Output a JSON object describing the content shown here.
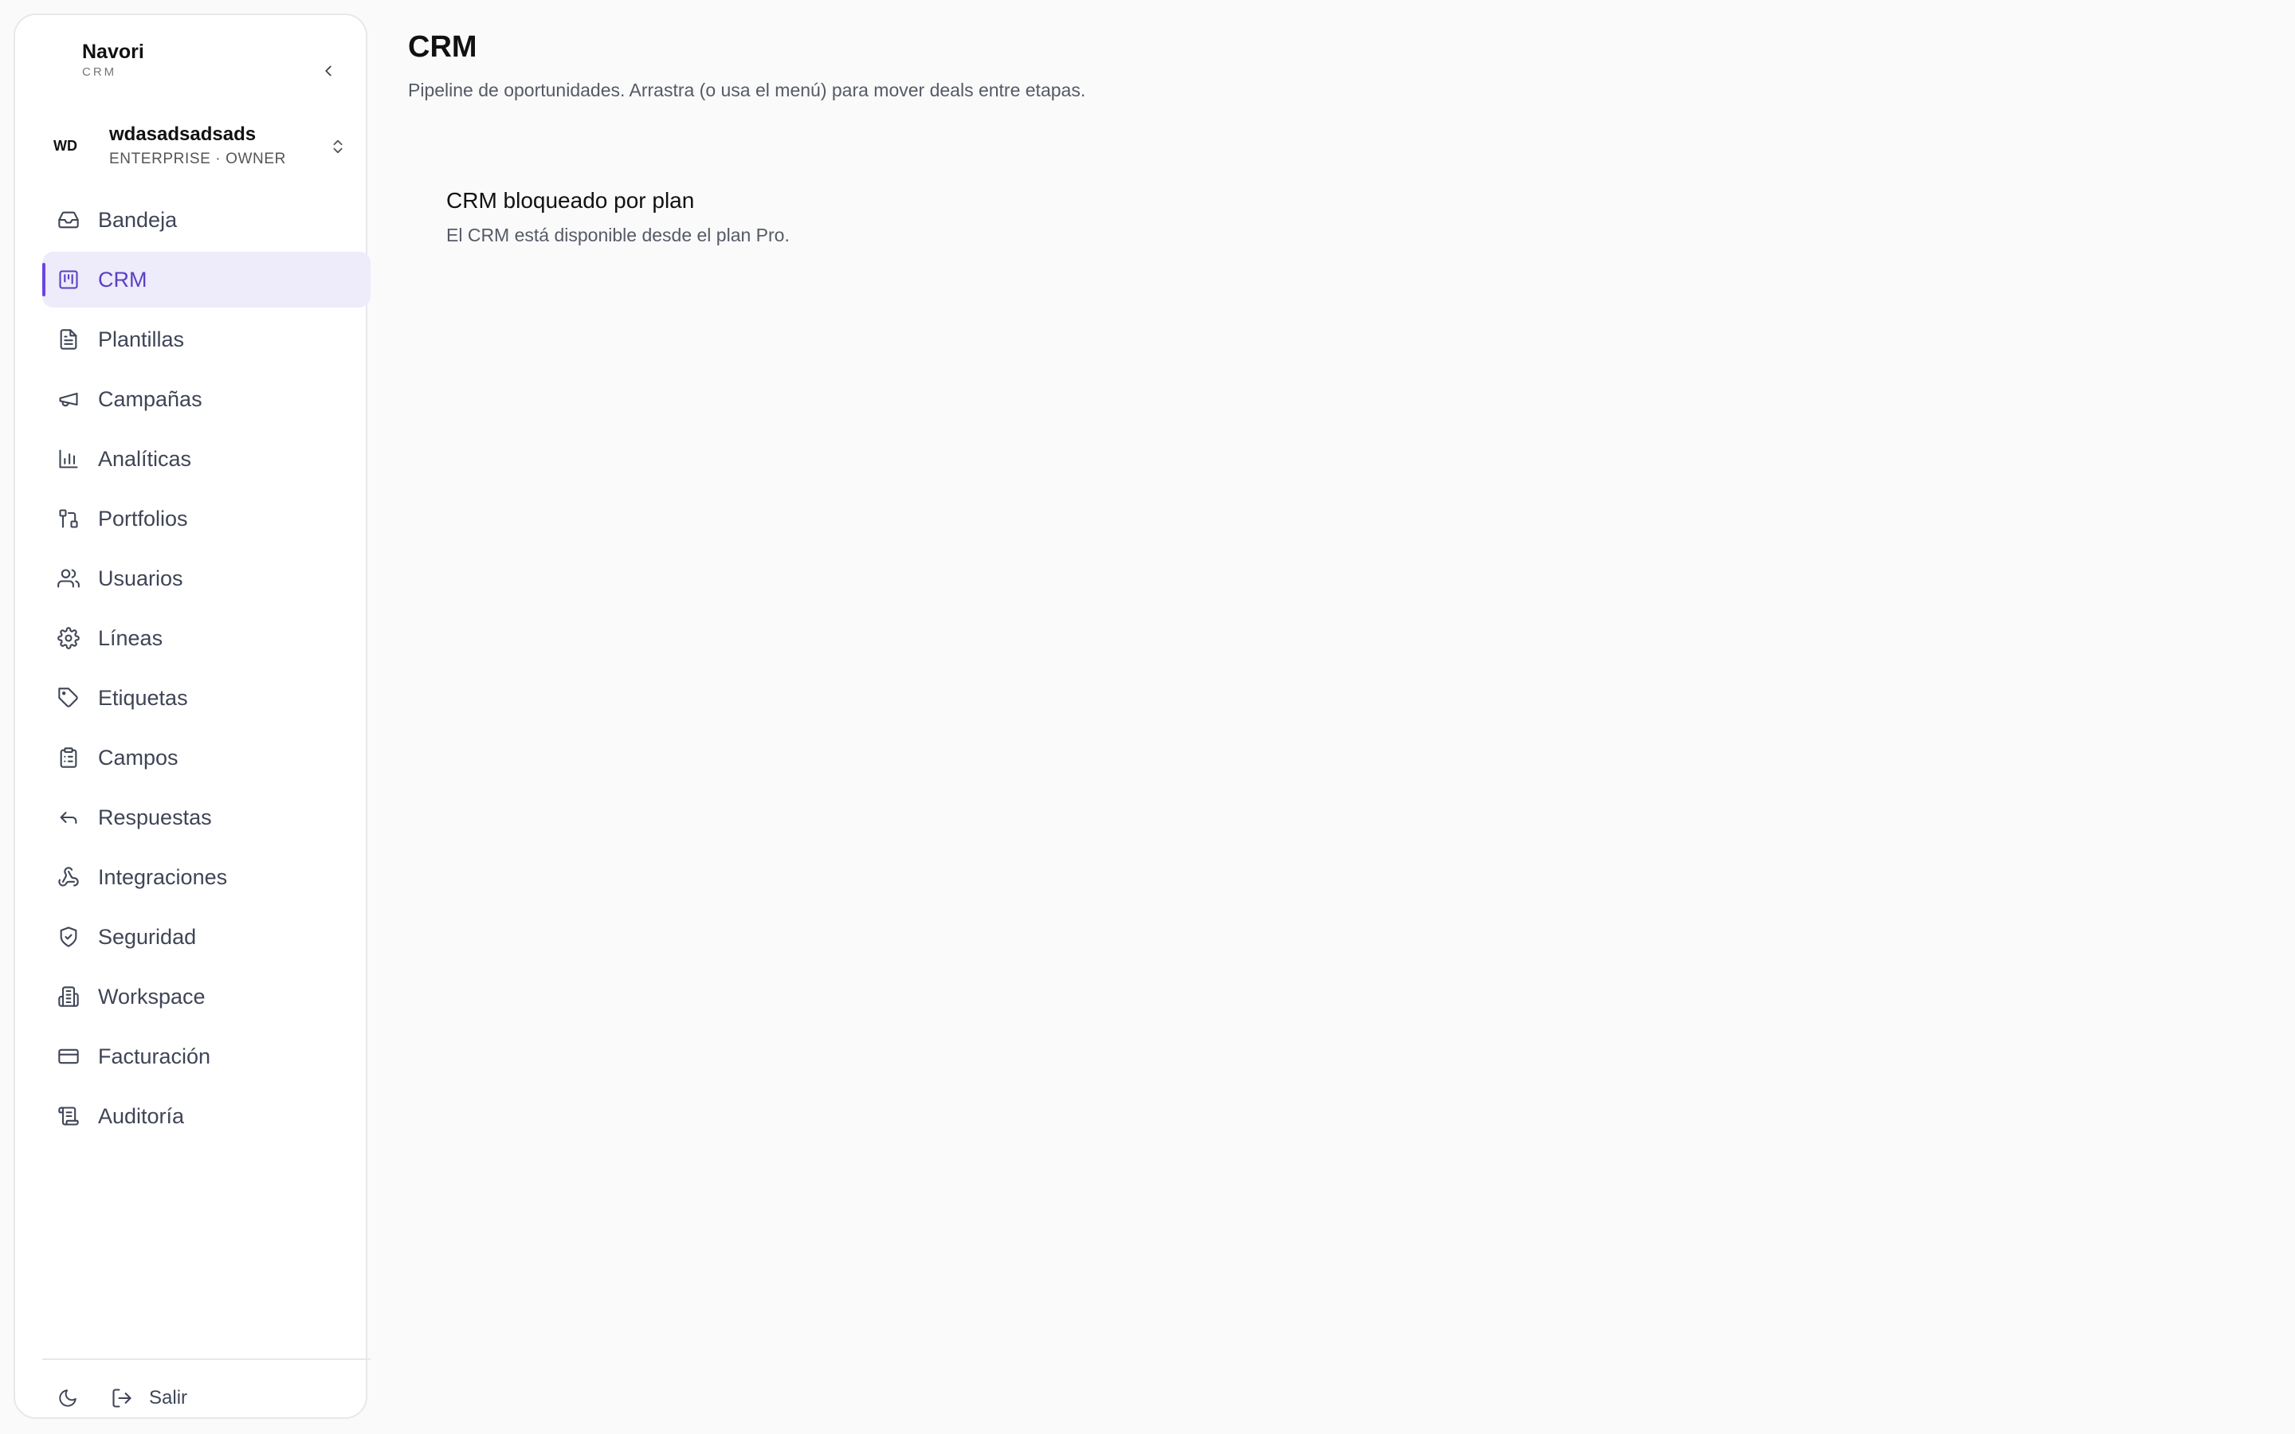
{
  "brand": {
    "name": "Navori",
    "subtitle": "CRM"
  },
  "workspace": {
    "initials": "WD",
    "name": "wdasadsadsads",
    "role": "ENTERPRISE · OWNER"
  },
  "sidebar": {
    "items": [
      {
        "label": "Bandeja",
        "icon": "inbox-icon",
        "active": false
      },
      {
        "label": "CRM",
        "icon": "kanban-icon",
        "active": true
      },
      {
        "label": "Plantillas",
        "icon": "file-text-icon",
        "active": false
      },
      {
        "label": "Campañas",
        "icon": "megaphone-icon",
        "active": false
      },
      {
        "label": "Analíticas",
        "icon": "bar-chart-icon",
        "active": false
      },
      {
        "label": "Portfolios",
        "icon": "route-icon",
        "active": false
      },
      {
        "label": "Usuarios",
        "icon": "users-icon",
        "active": false
      },
      {
        "label": "Líneas",
        "icon": "gear-icon",
        "active": false
      },
      {
        "label": "Etiquetas",
        "icon": "tag-icon",
        "active": false
      },
      {
        "label": "Campos",
        "icon": "clipboard-list-icon",
        "active": false
      },
      {
        "label": "Respuestas",
        "icon": "reply-icon",
        "active": false
      },
      {
        "label": "Integraciones",
        "icon": "webhook-icon",
        "active": false
      },
      {
        "label": "Seguridad",
        "icon": "shield-check-icon",
        "active": false
      },
      {
        "label": "Workspace",
        "icon": "building-icon",
        "active": false
      },
      {
        "label": "Facturación",
        "icon": "credit-card-icon",
        "active": false
      },
      {
        "label": "Auditoría",
        "icon": "scroll-icon",
        "active": false
      }
    ]
  },
  "footer": {
    "logout_label": "Salir"
  },
  "main": {
    "title": "CRM",
    "subtitle": "Pipeline de oportunidades. Arrastra (o usa el menú) para mover deals entre etapas.",
    "locked": {
      "title": "CRM bloqueado por plan",
      "description": "El CRM está disponible desde el plan Pro."
    }
  },
  "colors": {
    "accent": "#6b46e0",
    "active_bg": "#eeebfa",
    "text_muted": "#3f4556"
  }
}
